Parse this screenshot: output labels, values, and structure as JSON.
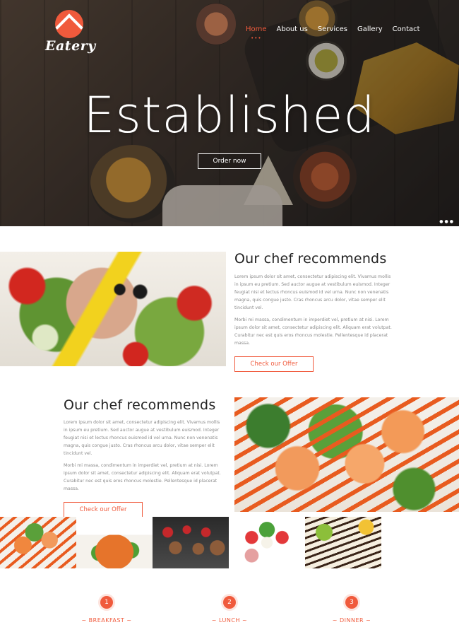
{
  "brand": {
    "name": "Eatery",
    "accent": "#f05a3c"
  },
  "nav": {
    "items": [
      {
        "label": "Home",
        "active": true
      },
      {
        "label": "About us",
        "active": false
      },
      {
        "label": "Services",
        "active": false
      },
      {
        "label": "Gallery",
        "active": false
      },
      {
        "label": "Contact",
        "active": false
      }
    ]
  },
  "hero": {
    "title": "Established",
    "cta": "Order now"
  },
  "section1": {
    "heading": "Our chef recommends",
    "paragraph1": "Lorem ipsum dolor sit amet, consectetur adipiscing elit. Vivamus mollis in ipsum eu pretium. Sed auctor augue at vestibulum euismod. Integer feugiat nisi et lectus rhoncus euismod id vel urna. Nunc non venenatis magna, quis congue justo. Cras rhoncus arcu dolor, vitae semper elit tincidunt vel.",
    "paragraph2": "Morbi mi massa, condimentum in imperdiet vel, pretium at nisi. Lorem ipsum dolor sit amet, consectetur adipiscing elit. Aliquam erat volutpat. Curabitur nec est quis eros rhoncus molestie. Pellentesque id placerat massa.",
    "button": "Check our Offer"
  },
  "section2": {
    "heading": "Our chef recommends",
    "paragraph1": "Lorem ipsum dolor sit amet, consectetur adipiscing elit. Vivamus mollis in ipsum eu pretium. Sed auctor augue at vestibulum euismod. Integer feugiat nisi et lectus rhoncus euismod id vel urna. Nunc non venenatis magna, quis congue justo. Cras rhoncus arcu dolor, vitae semper elit tincidunt vel.",
    "paragraph2": "Morbi mi massa, condimentum in imperdiet vel, pretium at nisi. Lorem ipsum dolor sit amet, consectetur adipiscing elit. Aliquam erat volutpat. Curabitur nec est quis eros rhoncus molestie. Pellentesque id placerat massa.",
    "button": "Check our Offer"
  },
  "meals": [
    {
      "number": "1",
      "label": "~ BREAKFAST ~"
    },
    {
      "number": "2",
      "label": "~ LUNCH ~"
    },
    {
      "number": "3",
      "label": "~ DINNER ~"
    }
  ]
}
